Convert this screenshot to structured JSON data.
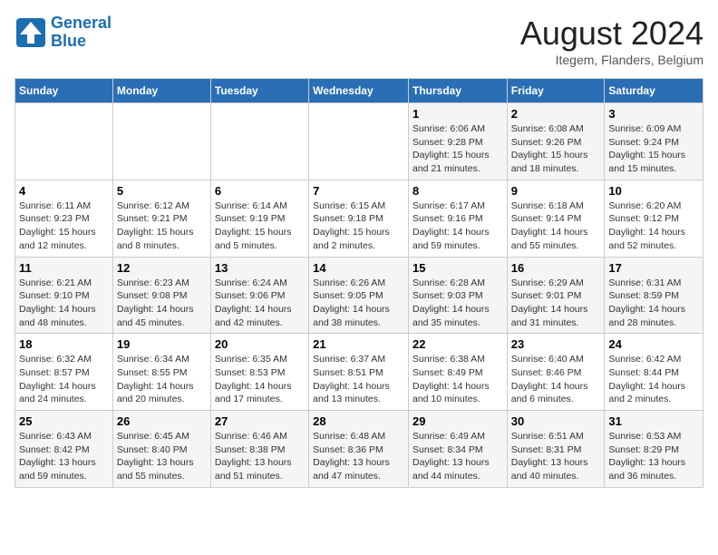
{
  "header": {
    "logo": {
      "line1": "General",
      "line2": "Blue"
    },
    "title": "August 2024",
    "subtitle": "Itegem, Flanders, Belgium"
  },
  "days_of_week": [
    "Sunday",
    "Monday",
    "Tuesday",
    "Wednesday",
    "Thursday",
    "Friday",
    "Saturday"
  ],
  "weeks": [
    [
      {
        "day": "",
        "info": ""
      },
      {
        "day": "",
        "info": ""
      },
      {
        "day": "",
        "info": ""
      },
      {
        "day": "",
        "info": ""
      },
      {
        "day": "1",
        "info": "Sunrise: 6:06 AM\nSunset: 9:28 PM\nDaylight: 15 hours\nand 21 minutes."
      },
      {
        "day": "2",
        "info": "Sunrise: 6:08 AM\nSunset: 9:26 PM\nDaylight: 15 hours\nand 18 minutes."
      },
      {
        "day": "3",
        "info": "Sunrise: 6:09 AM\nSunset: 9:24 PM\nDaylight: 15 hours\nand 15 minutes."
      }
    ],
    [
      {
        "day": "4",
        "info": "Sunrise: 6:11 AM\nSunset: 9:23 PM\nDaylight: 15 hours\nand 12 minutes."
      },
      {
        "day": "5",
        "info": "Sunrise: 6:12 AM\nSunset: 9:21 PM\nDaylight: 15 hours\nand 8 minutes."
      },
      {
        "day": "6",
        "info": "Sunrise: 6:14 AM\nSunset: 9:19 PM\nDaylight: 15 hours\nand 5 minutes."
      },
      {
        "day": "7",
        "info": "Sunrise: 6:15 AM\nSunset: 9:18 PM\nDaylight: 15 hours\nand 2 minutes."
      },
      {
        "day": "8",
        "info": "Sunrise: 6:17 AM\nSunset: 9:16 PM\nDaylight: 14 hours\nand 59 minutes."
      },
      {
        "day": "9",
        "info": "Sunrise: 6:18 AM\nSunset: 9:14 PM\nDaylight: 14 hours\nand 55 minutes."
      },
      {
        "day": "10",
        "info": "Sunrise: 6:20 AM\nSunset: 9:12 PM\nDaylight: 14 hours\nand 52 minutes."
      }
    ],
    [
      {
        "day": "11",
        "info": "Sunrise: 6:21 AM\nSunset: 9:10 PM\nDaylight: 14 hours\nand 48 minutes."
      },
      {
        "day": "12",
        "info": "Sunrise: 6:23 AM\nSunset: 9:08 PM\nDaylight: 14 hours\nand 45 minutes."
      },
      {
        "day": "13",
        "info": "Sunrise: 6:24 AM\nSunset: 9:06 PM\nDaylight: 14 hours\nand 42 minutes."
      },
      {
        "day": "14",
        "info": "Sunrise: 6:26 AM\nSunset: 9:05 PM\nDaylight: 14 hours\nand 38 minutes."
      },
      {
        "day": "15",
        "info": "Sunrise: 6:28 AM\nSunset: 9:03 PM\nDaylight: 14 hours\nand 35 minutes."
      },
      {
        "day": "16",
        "info": "Sunrise: 6:29 AM\nSunset: 9:01 PM\nDaylight: 14 hours\nand 31 minutes."
      },
      {
        "day": "17",
        "info": "Sunrise: 6:31 AM\nSunset: 8:59 PM\nDaylight: 14 hours\nand 28 minutes."
      }
    ],
    [
      {
        "day": "18",
        "info": "Sunrise: 6:32 AM\nSunset: 8:57 PM\nDaylight: 14 hours\nand 24 minutes."
      },
      {
        "day": "19",
        "info": "Sunrise: 6:34 AM\nSunset: 8:55 PM\nDaylight: 14 hours\nand 20 minutes."
      },
      {
        "day": "20",
        "info": "Sunrise: 6:35 AM\nSunset: 8:53 PM\nDaylight: 14 hours\nand 17 minutes."
      },
      {
        "day": "21",
        "info": "Sunrise: 6:37 AM\nSunset: 8:51 PM\nDaylight: 14 hours\nand 13 minutes."
      },
      {
        "day": "22",
        "info": "Sunrise: 6:38 AM\nSunset: 8:49 PM\nDaylight: 14 hours\nand 10 minutes."
      },
      {
        "day": "23",
        "info": "Sunrise: 6:40 AM\nSunset: 8:46 PM\nDaylight: 14 hours\nand 6 minutes."
      },
      {
        "day": "24",
        "info": "Sunrise: 6:42 AM\nSunset: 8:44 PM\nDaylight: 14 hours\nand 2 minutes."
      }
    ],
    [
      {
        "day": "25",
        "info": "Sunrise: 6:43 AM\nSunset: 8:42 PM\nDaylight: 13 hours\nand 59 minutes."
      },
      {
        "day": "26",
        "info": "Sunrise: 6:45 AM\nSunset: 8:40 PM\nDaylight: 13 hours\nand 55 minutes."
      },
      {
        "day": "27",
        "info": "Sunrise: 6:46 AM\nSunset: 8:38 PM\nDaylight: 13 hours\nand 51 minutes."
      },
      {
        "day": "28",
        "info": "Sunrise: 6:48 AM\nSunset: 8:36 PM\nDaylight: 13 hours\nand 47 minutes."
      },
      {
        "day": "29",
        "info": "Sunrise: 6:49 AM\nSunset: 8:34 PM\nDaylight: 13 hours\nand 44 minutes."
      },
      {
        "day": "30",
        "info": "Sunrise: 6:51 AM\nSunset: 8:31 PM\nDaylight: 13 hours\nand 40 minutes."
      },
      {
        "day": "31",
        "info": "Sunrise: 6:53 AM\nSunset: 8:29 PM\nDaylight: 13 hours\nand 36 minutes."
      }
    ]
  ]
}
